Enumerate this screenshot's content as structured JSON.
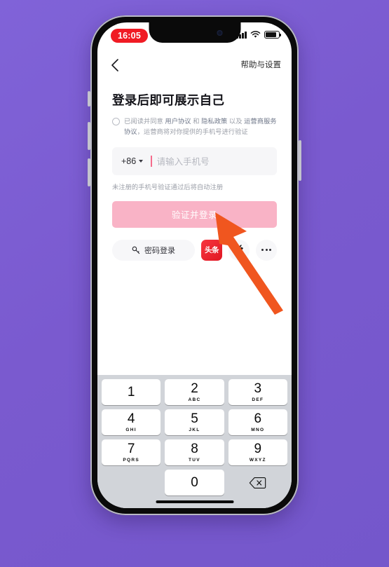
{
  "status_bar": {
    "time": "16:05",
    "signal_icon": "cellular-signal-icon",
    "wifi_icon": "wifi-icon",
    "battery_icon": "battery-icon"
  },
  "nav": {
    "back_icon": "back-chevron-icon",
    "help_label": "帮助与设置"
  },
  "login": {
    "title": "登录后即可展示自己",
    "agreement": {
      "prefix": "已阅读并同意",
      "link1": "用户协议",
      "conj1": "和",
      "link2": "隐私政策",
      "conj2": "以及",
      "link3": "运营商服务协议",
      "suffix": "，运营商将对你提供的手机号进行验证",
      "checkbox_state": "unchecked"
    },
    "country_code": "+86",
    "phone_placeholder": "请输入手机号",
    "phone_value": "",
    "hint": "未注册的手机号验证通过后将自动注册",
    "submit_label": "验证并登录",
    "submit_color": "#F9B3C6",
    "alt_logins": {
      "password_label": "密码登录",
      "password_icon": "key-icon",
      "toutiao_label": "头条",
      "toutiao_color": "#E81B26",
      "apple_icon": "apple-logo-icon",
      "more_icon": "ellipsis-icon"
    }
  },
  "keyboard": {
    "rows": [
      [
        {
          "num": "1",
          "sub": ""
        },
        {
          "num": "2",
          "sub": "ABC"
        },
        {
          "num": "3",
          "sub": "DEF"
        }
      ],
      [
        {
          "num": "4",
          "sub": "GHI"
        },
        {
          "num": "5",
          "sub": "JKL"
        },
        {
          "num": "6",
          "sub": "MNO"
        }
      ],
      [
        {
          "num": "7",
          "sub": "PQRS"
        },
        {
          "num": "8",
          "sub": "TUV"
        },
        {
          "num": "9",
          "sub": "WXYZ"
        }
      ]
    ],
    "zero_key": "0",
    "delete_icon": "backspace-icon"
  },
  "annotation": {
    "arrow_color": "#F05A28",
    "arrow_target": "验证并登录"
  },
  "background_color": "#7B5BD3"
}
